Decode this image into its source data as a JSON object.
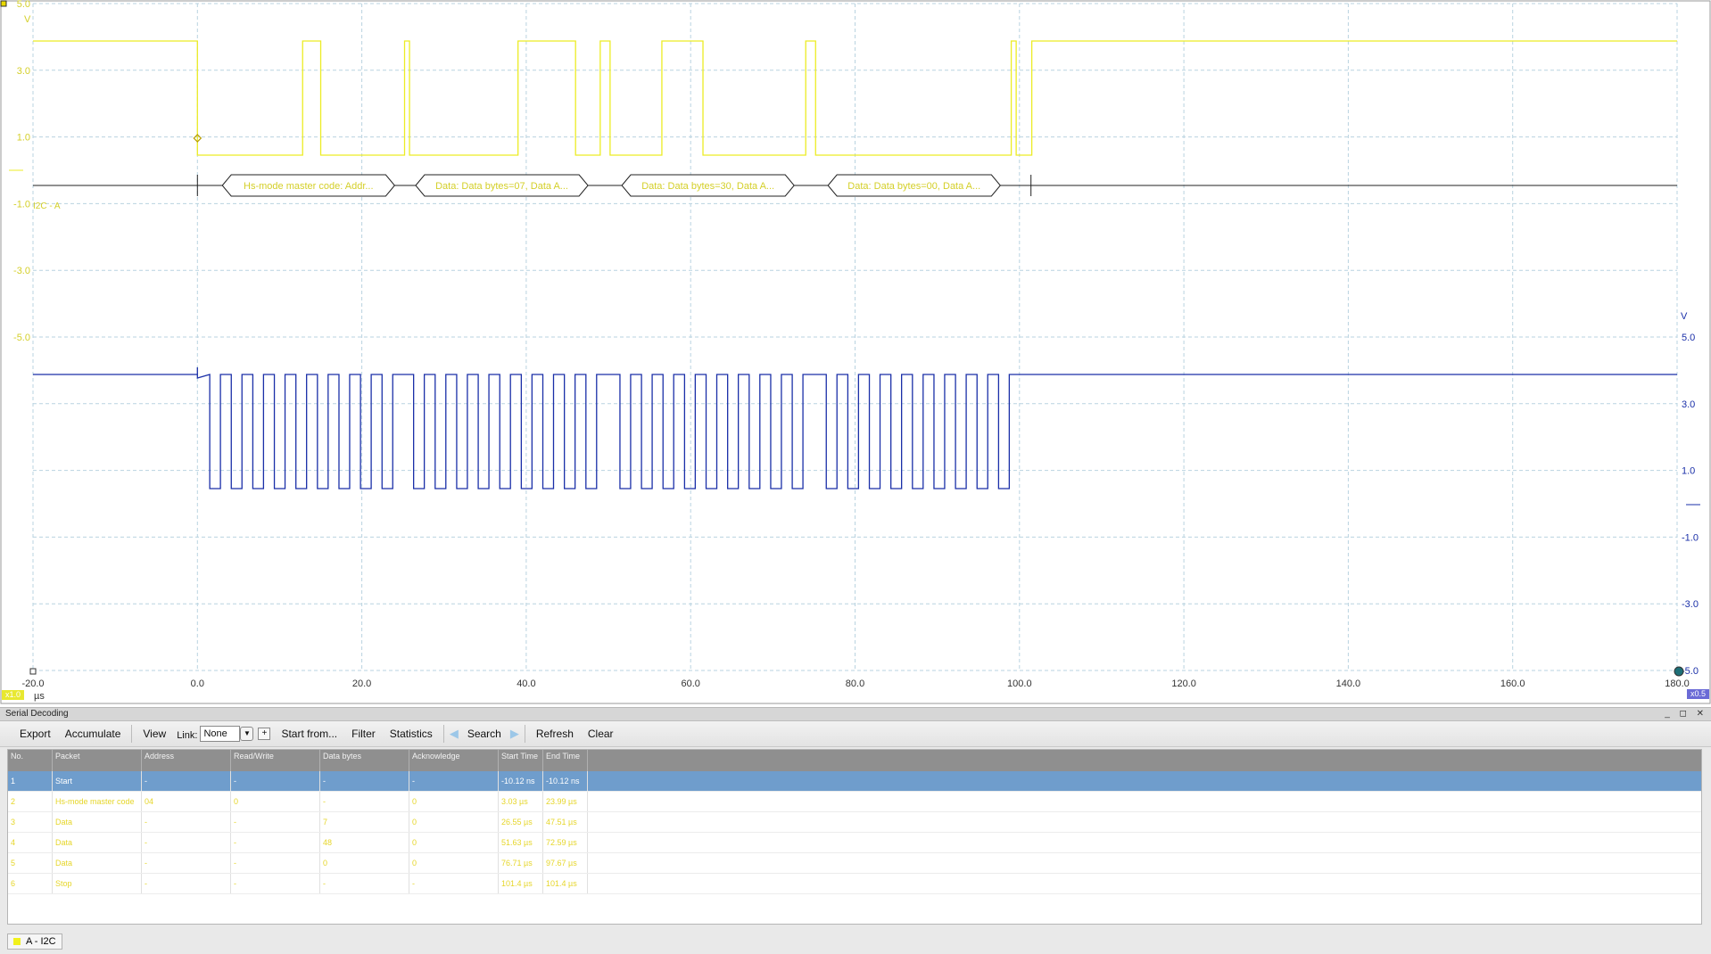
{
  "scope": {
    "channel_a_axis": {
      "unit": "V",
      "ticks": [
        "5.0",
        "3.0",
        "1.0",
        "-1.0",
        "-3.0",
        "-5.0"
      ],
      "color": "#d4cf28",
      "range_label": "x1.0"
    },
    "channel_b_axis": {
      "unit": "V",
      "ticks": [
        "5.0",
        "3.0",
        "1.0",
        "-1.0",
        "-3.0",
        "-5.0"
      ],
      "color": "#2a3fb5",
      "range_label": "x0.5"
    },
    "time_axis": {
      "unit": "µs",
      "ticks": [
        "-20.0",
        "0.0",
        "20.0",
        "40.0",
        "60.0",
        "80.0",
        "100.0",
        "120.0",
        "140.0",
        "160.0",
        "180.0"
      ]
    },
    "decode_label": "I2C - A",
    "packets": [
      "Hs-mode master code: Addr...",
      "Data: Data bytes=07, Data A...",
      "Data: Data bytes=30, Data A...",
      "Data: Data bytes=00, Data A..."
    ]
  },
  "panel": {
    "title": "Serial Decoding",
    "window_controls": "_ ◻ ✕",
    "toolbar": {
      "export": "Export",
      "accumulate": "Accumulate",
      "view": "View",
      "link_label": "Link:",
      "link_value": "None",
      "plus": "+",
      "start_from": "Start from...",
      "filter": "Filter",
      "statistics": "Statistics",
      "search": "Search",
      "refresh": "Refresh",
      "clear": "Clear"
    },
    "table": {
      "headers": [
        "No.",
        "Packet",
        "Address",
        "Read/Write",
        "Data bytes",
        "Acknowledge",
        "Start Time",
        "End Time"
      ],
      "rows": [
        [
          "1",
          "Start",
          "-",
          "-",
          "-",
          "-",
          "-10.12 ns",
          "-10.12 ns"
        ],
        [
          "2",
          "Hs-mode master code",
          "04",
          "0",
          "-",
          "0",
          "3.03 µs",
          "23.99 µs"
        ],
        [
          "3",
          "Data",
          "-",
          "-",
          "7",
          "0",
          "26.55 µs",
          "47.51 µs"
        ],
        [
          "4",
          "Data",
          "-",
          "-",
          "48",
          "0",
          "51.63 µs",
          "72.59 µs"
        ],
        [
          "5",
          "Data",
          "-",
          "-",
          "0",
          "0",
          "76.71 µs",
          "97.67 µs"
        ],
        [
          "6",
          "Stop",
          "-",
          "-",
          "-",
          "-",
          "101.4 µs",
          "101.4 µs"
        ]
      ]
    },
    "tab_label": "A - I2C"
  }
}
